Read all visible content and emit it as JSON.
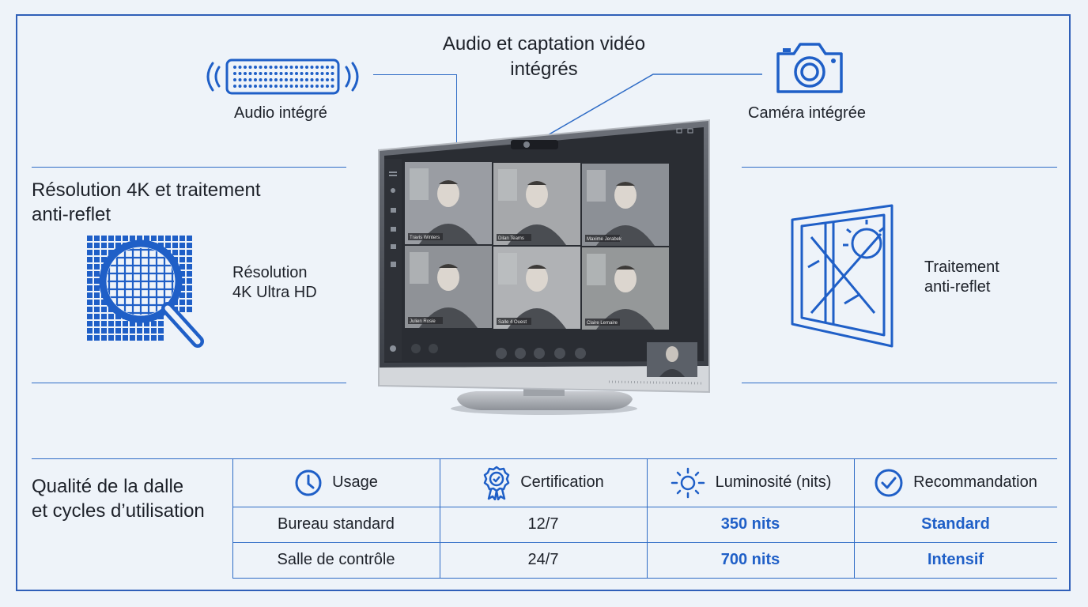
{
  "top": {
    "center_title": "Audio et captation vidéo intégrés",
    "center_title_line1": "Audio et captation vidéo",
    "center_title_line2": "intégrés",
    "audio_label": "Audio intégré",
    "camera_label": "Caméra intégrée"
  },
  "left": {
    "title_line1": "Résolution 4K et traitement",
    "title_line2": "anti-reflet",
    "res_line1": "Résolution",
    "res_line2": "4K Ultra HD"
  },
  "right": {
    "label_line1": "Traitement",
    "label_line2": "anti-reflet"
  },
  "bottom": {
    "title_line1": "Qualité de la dalle",
    "title_line2": "et cycles d’utilisation"
  },
  "table": {
    "headers": [
      {
        "label": "Usage",
        "icon": "clock-icon"
      },
      {
        "label": "Certification",
        "icon": "award-badge-icon"
      },
      {
        "label": "Luminosité (nits)",
        "icon": "sun-icon"
      },
      {
        "label": "Recommandation",
        "icon": "check-circle-icon"
      }
    ],
    "rows": [
      [
        "Bureau standard",
        "12/7",
        "350 nits",
        "Standard"
      ],
      [
        "Salle de contrôle",
        "24/7",
        "700 nits",
        "Intensif"
      ]
    ]
  },
  "monitor": {
    "tiles": [
      {
        "name": "Travis Winters"
      },
      {
        "name": "Dilan Teams"
      },
      {
        "name": "Maxime Jerabek"
      },
      {
        "name": "Julien Rosie"
      },
      {
        "name": "Salle 4 Ouest"
      },
      {
        "name": "Claire Lemaire"
      }
    ]
  },
  "colors": {
    "accent": "#1f5fc7",
    "line": "#2f6cc6",
    "background": "#eef3f9"
  }
}
